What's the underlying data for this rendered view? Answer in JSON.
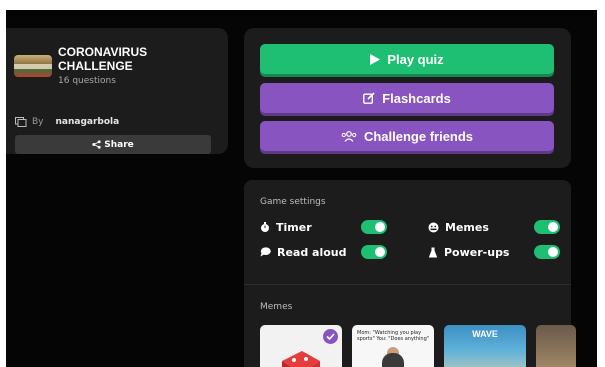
{
  "quiz": {
    "title": "CORONAVIRUS CHALLENGE",
    "question_count": "16 questions",
    "by_label": "By",
    "author": "nanagarbola",
    "share_label": "Share"
  },
  "actions": {
    "play_label": "Play quiz",
    "flashcards_label": "Flashcards",
    "challenge_label": "Challenge friends"
  },
  "settings": {
    "heading": "Game settings",
    "items": [
      {
        "label": "Timer",
        "icon": "timer-icon",
        "enabled": true
      },
      {
        "label": "Memes",
        "icon": "memes-icon",
        "enabled": true
      },
      {
        "label": "Read aloud",
        "icon": "speech-bubble-icon",
        "enabled": true
      },
      {
        "label": "Power-ups",
        "icon": "power-ups-icon",
        "enabled": true
      }
    ]
  },
  "memes": {
    "heading": "Memes",
    "thumbnails": [
      {
        "icon": "dice-icon",
        "selected": true,
        "caption": ""
      },
      {
        "icon": "person-meme",
        "selected": false,
        "caption": "Mom: \"Watching you play sports\" You: \"Does anything\""
      },
      {
        "icon": "wave-meme",
        "selected": false,
        "caption": "WAVE"
      },
      {
        "icon": "partial-meme",
        "selected": false,
        "caption": ""
      }
    ]
  },
  "colors": {
    "play_green": "#1fbf73",
    "purple": "#8854c0",
    "toggle_on": "#1fbf73",
    "panel_bg": "#1c1c1c",
    "page_bg": "#050505"
  }
}
